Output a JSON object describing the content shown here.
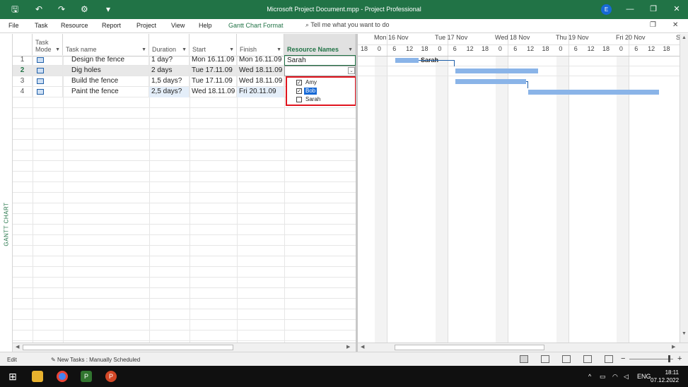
{
  "window": {
    "title": "Microsoft Project Document.mpp - Project Professional",
    "avatar_initial": "E",
    "controls": {
      "minimize": "—",
      "restore": "❐",
      "close": "✕"
    }
  },
  "quick_access": {
    "save": "🖫",
    "undo": "↶",
    "redo": "↷",
    "touch": "⚙",
    "customize": "▾"
  },
  "menu": {
    "items": [
      "File",
      "Task",
      "Resource",
      "Report",
      "Project",
      "View",
      "Help",
      "Gantt Chart Format"
    ],
    "active": "Gantt Chart Format",
    "search_placeholder": "Tell me what you want to do"
  },
  "view_label": "GANTT CHART",
  "table": {
    "headers": {
      "mode_line1": "Task",
      "mode_line2": "Mode",
      "name": "Task name",
      "duration": "Duration",
      "start": "Start",
      "finish": "Finish",
      "resources": "Resource Names"
    },
    "rows": [
      {
        "id": "1",
        "name": "Design the fence",
        "duration": "1 day?",
        "start": "Mon 16.11.09",
        "finish": "Mon 16.11.09",
        "resources": "Sarah"
      },
      {
        "id": "2",
        "name": "Dig holes",
        "duration": "2 days",
        "start": "Tue 17.11.09",
        "finish": "Wed 18.11.09",
        "resources": ""
      },
      {
        "id": "3",
        "name": "Build the fence",
        "duration": "1,5 days?",
        "start": "Tue 17.11.09",
        "finish": "Wed 18.11.09",
        "resources": ""
      },
      {
        "id": "4",
        "name": "Paint the fence",
        "duration": "2,5 days?",
        "start": "Wed 18.11.09",
        "finish": "Fri 20.11.09",
        "resources": ""
      }
    ]
  },
  "resource_dropdown": {
    "options": [
      {
        "label": "Amy",
        "checked": true,
        "selected": false
      },
      {
        "label": "Bob",
        "checked": true,
        "selected": true
      },
      {
        "label": "Sarah",
        "checked": false,
        "selected": false
      }
    ]
  },
  "timescale": {
    "days": [
      "Mon 16 Nov",
      "Tue 17 Nov",
      "Wed 18 Nov",
      "Thu 19 Nov",
      "Fri 20 Nov",
      "S"
    ],
    "ticks": [
      "18",
      "0",
      "6",
      "12",
      "18",
      "0",
      "6",
      "12",
      "18",
      "0",
      "6",
      "12",
      "18",
      "0",
      "6",
      "12",
      "18",
      "0",
      "6",
      "12",
      "18"
    ]
  },
  "gantt": {
    "bar_color": "#8ab4e8",
    "bar_label": "Sarah"
  },
  "status": {
    "mode": "Edit",
    "new_tasks": "New Tasks : Manually Scheduled"
  },
  "taskbar": {
    "tray": {
      "chevron": "^",
      "lang": "ENG",
      "time": "18:11",
      "date": "07.12.2022"
    },
    "apps": [
      "windows-start",
      "file-explorer",
      "chrome",
      "project",
      "powerpoint"
    ]
  },
  "colors": {
    "accent": "#217346",
    "highlight": "#e0141e",
    "selection": "#1769d6"
  }
}
